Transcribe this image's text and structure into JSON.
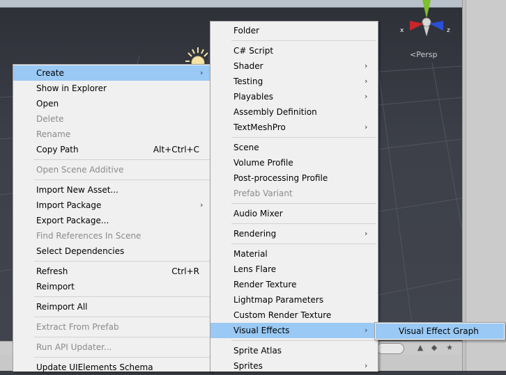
{
  "scene": {
    "view_label": "Persp",
    "gizmo_axes": {
      "x": "x",
      "z": "z"
    },
    "gizmo_colors": {
      "x": "#c8262b",
      "y": "#7fbf2a",
      "z": "#2a4fd8"
    },
    "icons": [
      "sun-icon",
      "scene-gizmo"
    ]
  },
  "bottom_toolbar": {
    "icons": [
      "layers-icon",
      "tag-icon",
      "star-icon"
    ]
  },
  "context_menu": {
    "items": [
      {
        "label": "Create",
        "submenu": true,
        "highlighted": true
      },
      {
        "label": "Show in Explorer"
      },
      {
        "label": "Open"
      },
      {
        "label": "Delete",
        "disabled": true
      },
      {
        "label": "Rename",
        "disabled": true
      },
      {
        "label": "Copy Path",
        "shortcut": "Alt+Ctrl+C"
      },
      {
        "label": "Open Scene Additive",
        "disabled": true
      },
      {
        "label": "Import New Asset..."
      },
      {
        "label": "Import Package",
        "submenu": true
      },
      {
        "label": "Export Package..."
      },
      {
        "label": "Find References In Scene",
        "disabled": true
      },
      {
        "label": "Select Dependencies"
      },
      {
        "label": "Refresh",
        "shortcut": "Ctrl+R"
      },
      {
        "label": "Reimport"
      },
      {
        "label": "Reimport All"
      },
      {
        "label": "Extract From Prefab",
        "disabled": true
      },
      {
        "label": "Run API Updater...",
        "disabled": true
      },
      {
        "label": "Update UIElements Schema"
      }
    ]
  },
  "create_menu": {
    "items": [
      {
        "label": "Folder"
      },
      {
        "label": "C# Script"
      },
      {
        "label": "Shader",
        "submenu": true
      },
      {
        "label": "Testing",
        "submenu": true
      },
      {
        "label": "Playables",
        "submenu": true
      },
      {
        "label": "Assembly Definition"
      },
      {
        "label": "TextMeshPro",
        "submenu": true
      },
      {
        "label": "Scene"
      },
      {
        "label": "Volume Profile"
      },
      {
        "label": "Post-processing Profile"
      },
      {
        "label": "Prefab Variant",
        "disabled": true
      },
      {
        "label": "Audio Mixer"
      },
      {
        "label": "Rendering",
        "submenu": true
      },
      {
        "label": "Material"
      },
      {
        "label": "Lens Flare"
      },
      {
        "label": "Render Texture"
      },
      {
        "label": "Lightmap Parameters"
      },
      {
        "label": "Custom Render Texture"
      },
      {
        "label": "Visual Effects",
        "submenu": true,
        "highlighted": true
      },
      {
        "label": "Sprite Atlas"
      },
      {
        "label": "Sprites",
        "submenu": true
      }
    ]
  },
  "vfx_menu": {
    "items": [
      {
        "label": "Visual Effect Graph",
        "highlighted": true
      }
    ]
  },
  "arrow_glyph": "›"
}
